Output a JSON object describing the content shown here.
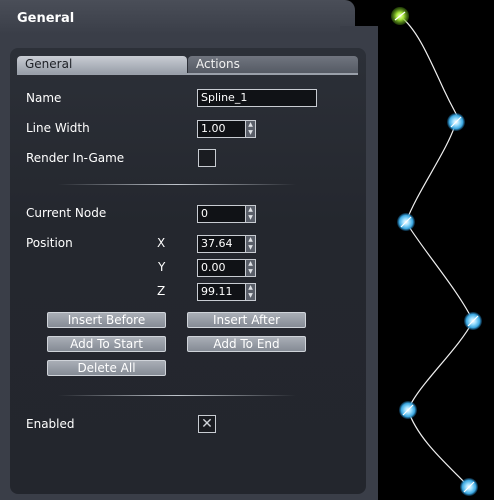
{
  "panel": {
    "title": "General"
  },
  "tabs": [
    {
      "label": "General",
      "active": true
    },
    {
      "label": "Actions",
      "active": false
    }
  ],
  "fields": {
    "name": {
      "label": "Name",
      "value": "Spline_1"
    },
    "line_width": {
      "label": "Line Width",
      "value": "1.00"
    },
    "render_in_game": {
      "label": "Render In-Game",
      "checked": false
    },
    "current_node": {
      "label": "Current Node",
      "value": "0"
    },
    "position": {
      "label": "Position",
      "x": {
        "axis": "X",
        "value": "37.64"
      },
      "y": {
        "axis": "Y",
        "value": "0.00"
      },
      "z": {
        "axis": "Z",
        "value": "99.11"
      }
    },
    "enabled": {
      "label": "Enabled",
      "checked": true
    }
  },
  "buttons": {
    "insert_before": "Insert Before",
    "insert_after": "Insert After",
    "add_to_start": "Add To Start",
    "add_to_end": "Add To End",
    "delete_all": "Delete All"
  },
  "viewport": {
    "node_count": 6,
    "selected_node_index": 0,
    "colors": {
      "selected_node": "#7fd21e",
      "node": "#4fb9f0",
      "curve": "#f0f0f0"
    }
  }
}
